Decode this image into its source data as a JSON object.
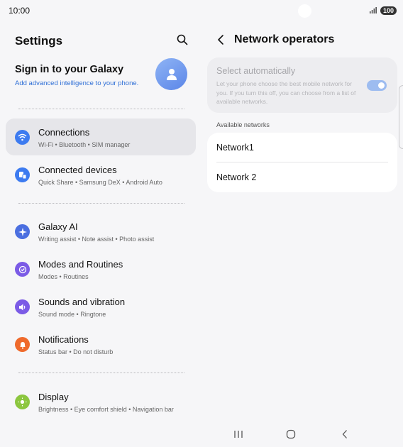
{
  "status_bar": {
    "time": "10:00",
    "battery": "100"
  },
  "left_pane": {
    "title": "Settings",
    "account": {
      "title": "Sign in to your Galaxy",
      "subtitle": "Add advanced intelligence to your phone."
    },
    "items": [
      {
        "title": "Connections",
        "subtitle": "Wi-Fi  •  Bluetooth  •  SIM manager",
        "icon": "wifi-icon",
        "color": "#3d7bf0",
        "active": true
      },
      {
        "title": "Connected devices",
        "subtitle": "Quick Share  •  Samsung DeX  •  Android Auto",
        "icon": "devices-icon",
        "color": "#3d7bf0"
      },
      {
        "title": "Galaxy AI",
        "subtitle": "Writing assist  •  Note assist  •  Photo assist",
        "icon": "sparkle-icon",
        "color": "#4b6fe0"
      },
      {
        "title": "Modes and Routines",
        "subtitle": "Modes  •  Routines",
        "icon": "routine-icon",
        "color": "#7b5be6"
      },
      {
        "title": "Sounds and vibration",
        "subtitle": "Sound mode  •  Ringtone",
        "icon": "speaker-icon",
        "color": "#7b5be6"
      },
      {
        "title": "Notifications",
        "subtitle": "Status bar  •  Do not disturb",
        "icon": "bell-icon",
        "color": "#ef6a2c"
      },
      {
        "title": "Display",
        "subtitle": "Brightness  •  Eye comfort shield  •  Navigation bar",
        "icon": "sun-icon",
        "color": "#8cc63f"
      }
    ]
  },
  "right_pane": {
    "title": "Network operators",
    "auto_select": {
      "title": "Select automatically",
      "description": "Let your phone choose the best mobile network for you. If you turn this off, you can choose from a list of available networks.",
      "enabled": true
    },
    "available_label": "Available networks",
    "networks": [
      "Network1",
      "Network 2"
    ]
  }
}
